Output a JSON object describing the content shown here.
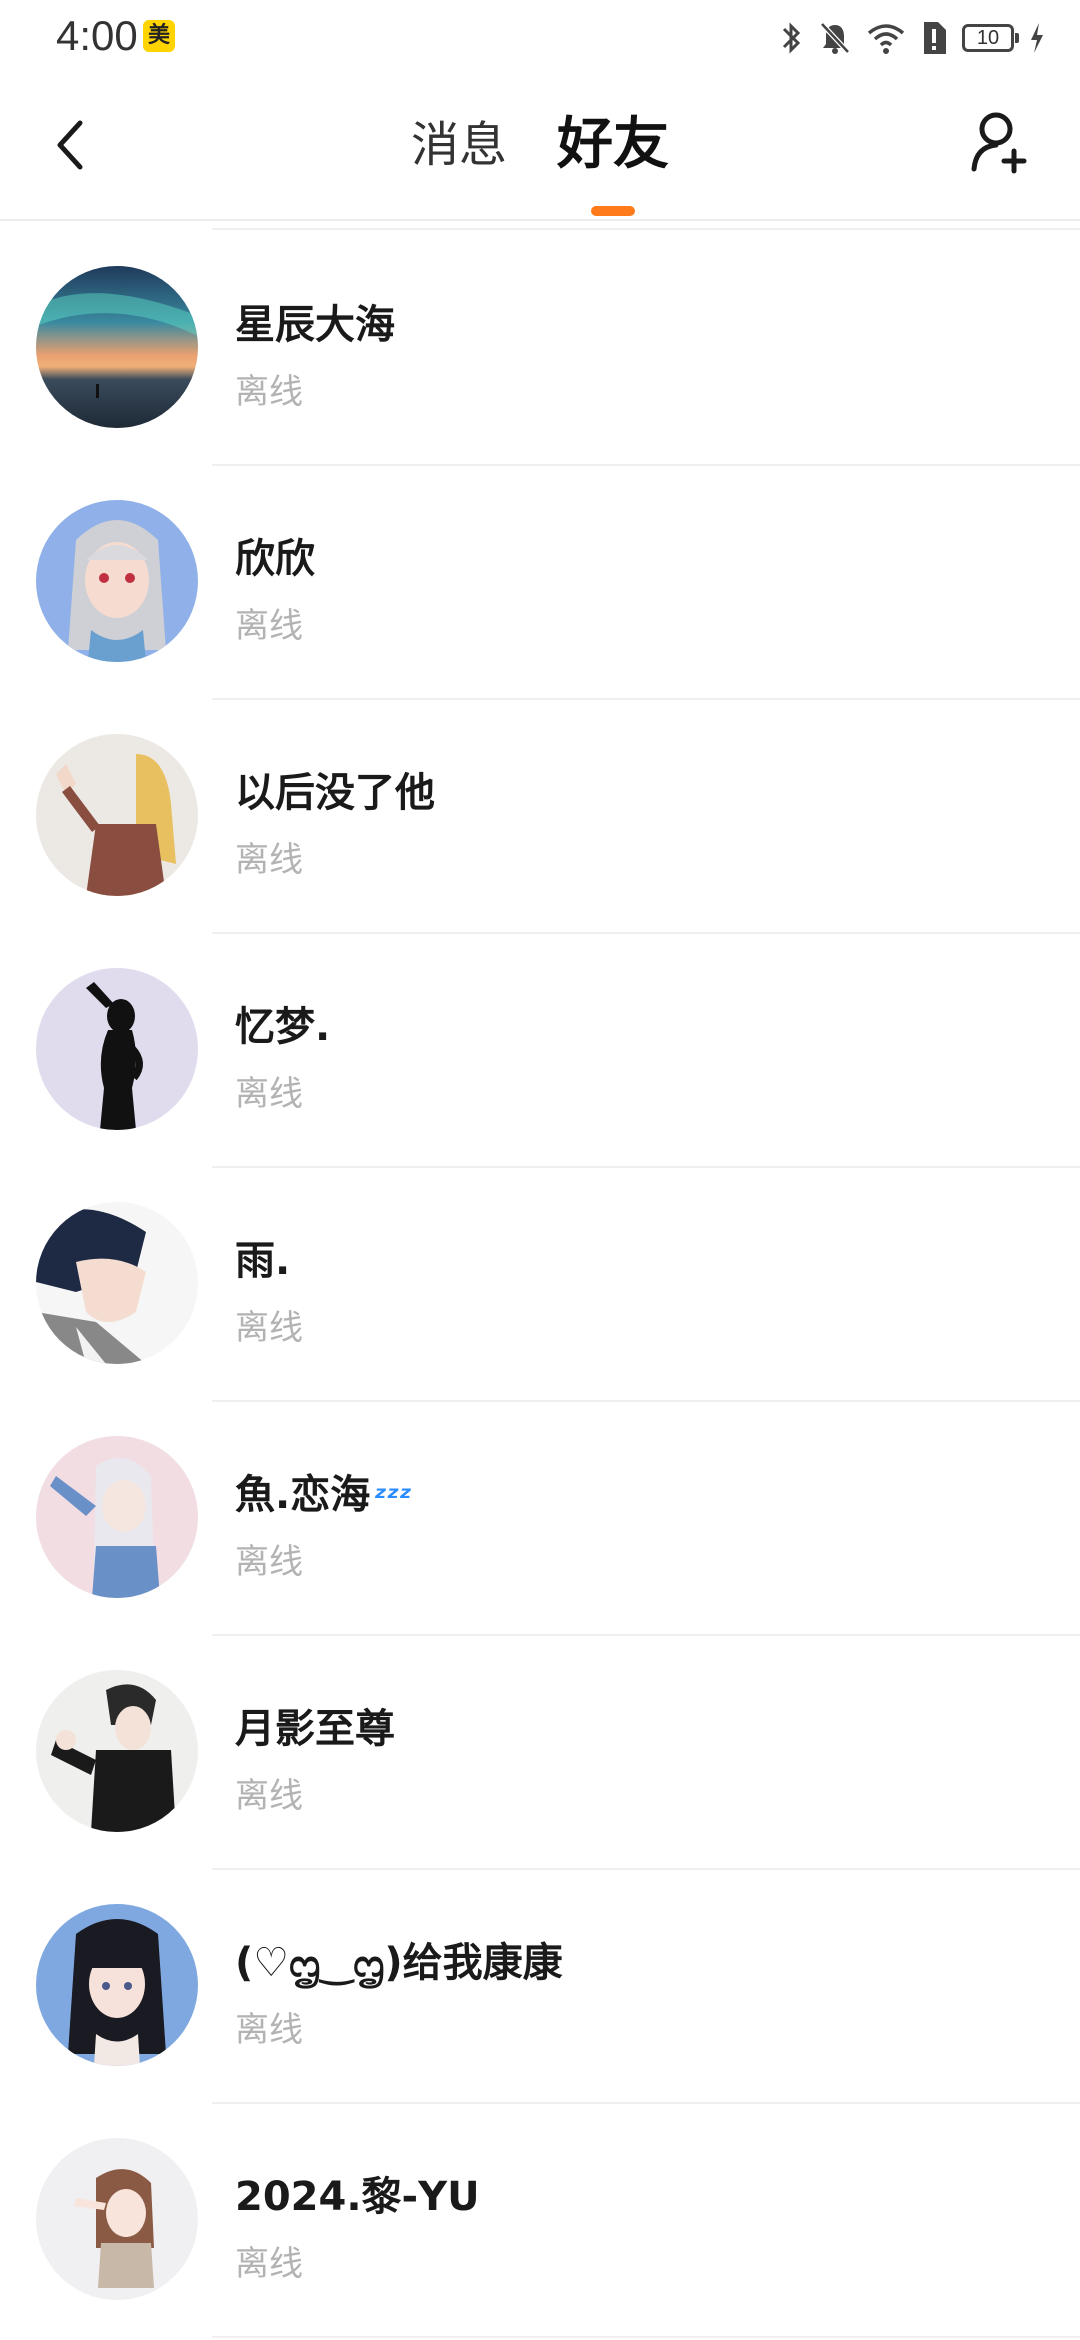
{
  "status_bar": {
    "time": "4:00",
    "app_badge": "美",
    "battery_level": "10"
  },
  "header": {
    "tabs": [
      {
        "label": "消息",
        "active": false
      },
      {
        "label": "好友",
        "active": true
      }
    ],
    "accent_color": "#ff7a1a"
  },
  "friends": [
    {
      "name": "星辰大海",
      "status": "离线",
      "avatar": "aurora-sunset-avatar"
    },
    {
      "name": "欣欣",
      "status": "离线",
      "avatar": "anime-girl-silver-hair-avatar"
    },
    {
      "name": "以后没了他",
      "status": "离线",
      "avatar": "blonde-girl-frame-avatar"
    },
    {
      "name": "忆梦.",
      "status": "离线",
      "avatar": "silhouette-woman-avatar"
    },
    {
      "name": "雨.",
      "status": "离线",
      "avatar": "anime-boy-profile-avatar"
    },
    {
      "name": "魚.恋海",
      "name_suffix": "💤",
      "status": "离线",
      "avatar": "anime-girl-salute-avatar"
    },
    {
      "name": "月影至尊",
      "status": "离线",
      "avatar": "anime-boy-dark-avatar"
    },
    {
      "name": "(♡ᦗ‿ᦗ)给我康康",
      "status": "离线",
      "avatar": "anime-girl-black-hair-avatar"
    },
    {
      "name": "2024.黎-YU",
      "status": "离线",
      "avatar": "chibi-girl-salute-avatar"
    }
  ]
}
